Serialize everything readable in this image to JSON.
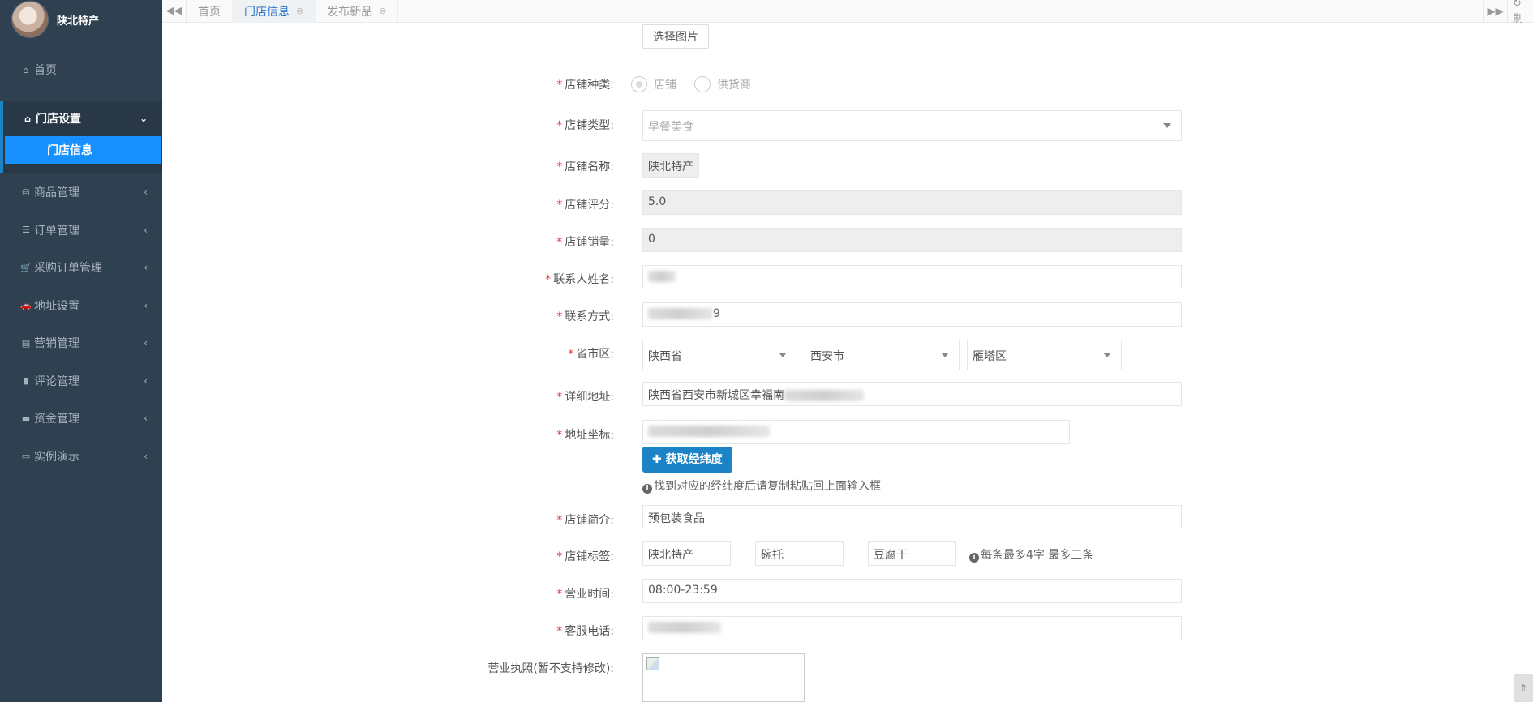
{
  "sidebar": {
    "user_name": "陕北特产",
    "items": [
      {
        "label": "首页",
        "icon": "home-icon",
        "glyph": "⌂",
        "arrow": ""
      },
      {
        "label": "门店设置",
        "icon": "home-icon",
        "glyph": "⌂",
        "arrow": "⌄"
      },
      {
        "label": "商品管理",
        "icon": "cubes-icon",
        "glyph": "⛁",
        "arrow": "‹"
      },
      {
        "label": "订单管理",
        "icon": "list-icon",
        "glyph": "☰",
        "arrow": "‹"
      },
      {
        "label": "采购订单管理",
        "icon": "cart-icon",
        "glyph": "🛒",
        "arrow": "‹"
      },
      {
        "label": "地址设置",
        "icon": "car-icon",
        "glyph": "🚗",
        "arrow": "‹"
      },
      {
        "label": "营销管理",
        "icon": "book-icon",
        "glyph": "▤",
        "arrow": "‹"
      },
      {
        "label": "评论管理",
        "icon": "bookmark-icon",
        "glyph": "▮",
        "arrow": "‹"
      },
      {
        "label": "资金管理",
        "icon": "money-icon",
        "glyph": "▬",
        "arrow": "‹"
      },
      {
        "label": "实例演示",
        "icon": "desktop-icon",
        "glyph": "▭",
        "arrow": "‹"
      }
    ],
    "subitem": "门店信息"
  },
  "tabs": {
    "items": [
      "首页",
      "门店信息",
      "发布新品"
    ],
    "close_glyph": "⊗",
    "back_glyph": "◀◀",
    "forward_glyph": "▶▶",
    "refresh_glyph": "↻ 刷"
  },
  "form": {
    "choose_image_button": "选择图片",
    "store_kind": {
      "label": "店铺种类:",
      "options": [
        "店铺",
        "供货商"
      ],
      "selected": "店铺"
    },
    "store_type": {
      "label": "店铺类型:",
      "value": "早餐美食"
    },
    "store_name": {
      "label": "店铺名称:",
      "value": "陕北特产"
    },
    "store_rating": {
      "label": "店铺评分:",
      "value": "5.0"
    },
    "store_sales": {
      "label": "店铺销量:",
      "value": "0"
    },
    "contact_name": {
      "label": "联系人姓名:"
    },
    "contact_phone": {
      "label": "联系方式:",
      "value_suffix": "9"
    },
    "region": {
      "label": "省市区:",
      "province": "陕西省",
      "city": "西安市",
      "district": "雁塔区"
    },
    "address": {
      "label": "详细地址:",
      "value": "陕西省西安市新城区幸福南"
    },
    "coords": {
      "label": "地址坐标:",
      "button": "获取经纬度",
      "hint": "找到对应的经纬度后请复制粘贴回上面输入框"
    },
    "intro": {
      "label": "店铺简介:",
      "value": "预包装食品"
    },
    "tags": {
      "label": "店铺标签:",
      "values": [
        "陕北特产",
        "碗托",
        "豆腐干"
      ],
      "hint": "每条最多4字 最多三条"
    },
    "hours": {
      "label": "营业时间:",
      "value": "08:00-23:59"
    },
    "service_phone": {
      "label": "客服电话:"
    },
    "license": {
      "label": "营业执照(暂不支持修改):"
    }
  },
  "colors": {
    "sidebar_bg": "#2f4050",
    "accent_blue": "#1890ff",
    "primary_button": "#1c84c6",
    "required_star": "#e4393c"
  }
}
